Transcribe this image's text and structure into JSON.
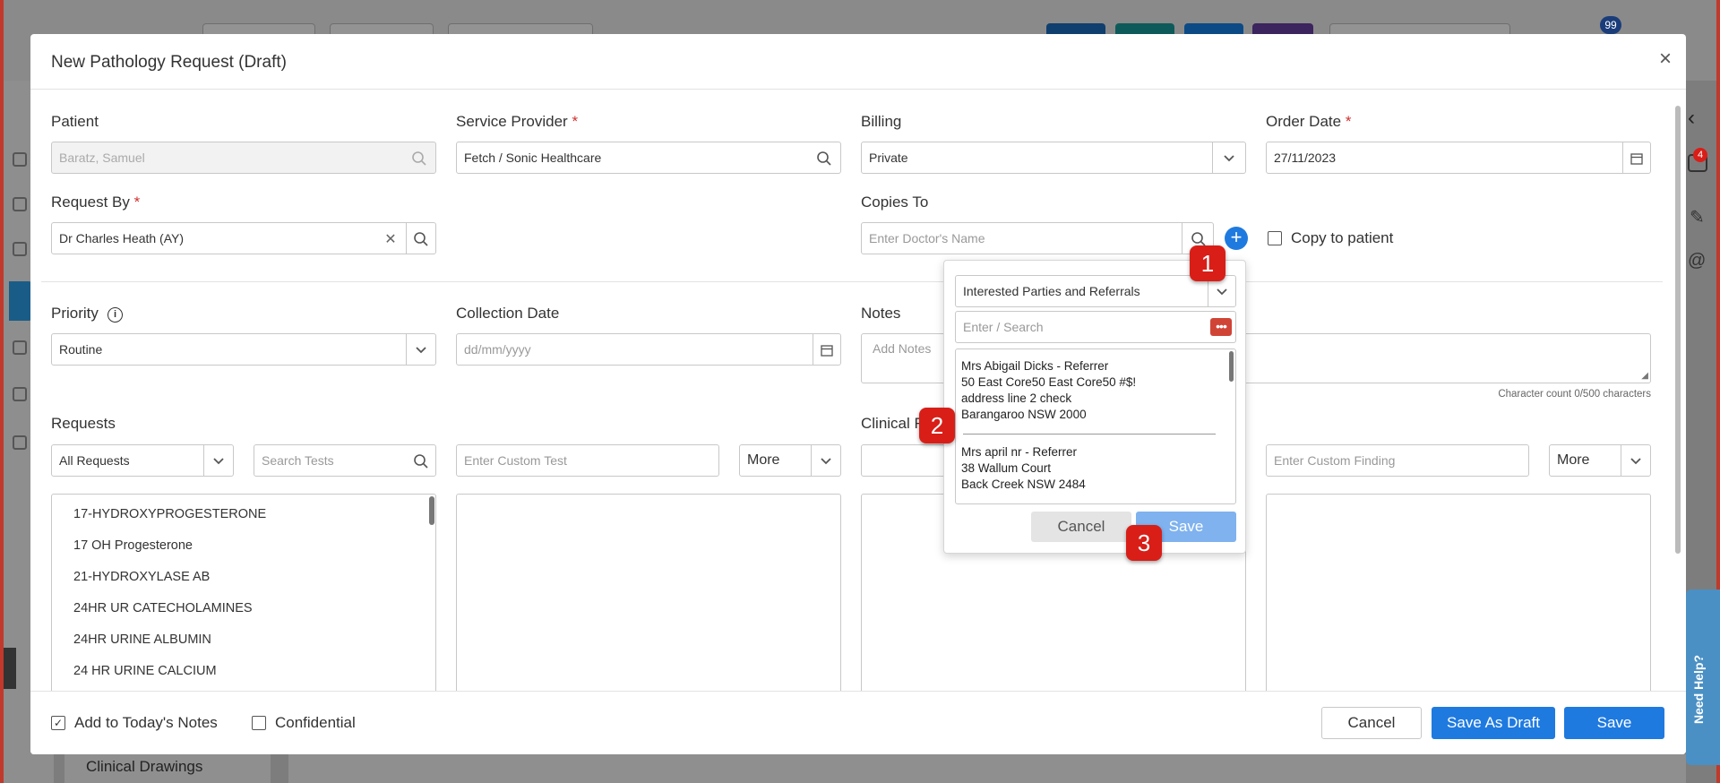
{
  "background": {
    "notification_count": "99",
    "sidebar_bottom_label": "Clinical Drawings"
  },
  "modal": {
    "title": "New Pathology Request (Draft)"
  },
  "patient": {
    "label": "Patient",
    "value": "Baratz, Samuel"
  },
  "service_provider": {
    "label": "Service Provider",
    "value": "Fetch / Sonic Healthcare"
  },
  "billing": {
    "label": "Billing",
    "value": "Private"
  },
  "order_date": {
    "label": "Order Date",
    "value": "27/11/2023"
  },
  "request_by": {
    "label": "Request By",
    "value": "Dr Charles Heath (AY)"
  },
  "copies_to": {
    "label": "Copies To",
    "placeholder": "Enter Doctor's Name",
    "copy_to_patient": "Copy to patient"
  },
  "priority": {
    "label": "Priority",
    "value": "Routine"
  },
  "collection_date": {
    "label": "Collection Date",
    "placeholder": "dd/mm/yyyy"
  },
  "notes": {
    "label": "Notes",
    "placeholder": "Add Notes",
    "char_count": "Character count 0/500 characters"
  },
  "requests": {
    "label": "Requests",
    "filter": "All Requests",
    "search_placeholder": "Search Tests",
    "custom_placeholder": "Enter Custom Test",
    "more": "More",
    "items": [
      "17-HYDROXYPROGESTERONE",
      "17 OH Progesterone",
      "21-HYDROXYLASE AB",
      "24HR UR CATECHOLAMINES",
      "24HR URINE ALBUMIN",
      "24 HR URINE CALCIUM"
    ]
  },
  "clinical": {
    "label_fragment": "Clinical F",
    "custom_placeholder": "Enter Custom Finding",
    "more": "More"
  },
  "popup": {
    "dropdown": "Interested Parties and Referrals",
    "search_placeholder": "Enter / Search",
    "entries": [
      {
        "lines": [
          "Mrs Abigail Dicks - Referrer",
          "50 East Core50 East Core50 #$!",
          "address line 2 check",
          "Barangaroo NSW 2000"
        ]
      },
      {
        "lines": [
          "Mrs april nr - Referrer",
          "38 Wallum Court",
          "Back Creek NSW 2484"
        ]
      }
    ],
    "cancel": "Cancel",
    "save": "Save"
  },
  "footer": {
    "add_to_notes": "Add to Today's Notes",
    "confidential": "Confidential",
    "cancel": "Cancel",
    "save_draft": "Save As Draft",
    "save": "Save"
  },
  "markers": [
    "1",
    "2",
    "3"
  ],
  "side": {
    "badge": "4",
    "help": "Need Help?"
  },
  "colors": {
    "primary": "#1f7ae0",
    "marker": "#d91e18",
    "required": "#d32f2f",
    "save_disabled": "#7fb2ee"
  }
}
